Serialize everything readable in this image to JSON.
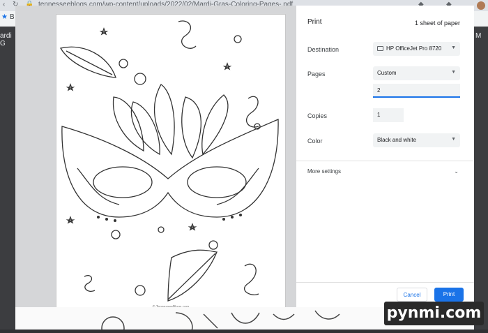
{
  "browser": {
    "url": "tennesseeblogs.com/wp-content/uploads/2022/02/Mardi-Gras-Coloring-Pages-.pdf",
    "bookmark_fragment": "B",
    "left_tab_fragment": "ardi G",
    "right_tab_fragment": "M"
  },
  "print_dialog": {
    "title": "Print",
    "sheets": "1 sheet of paper",
    "destination": {
      "label": "Destination",
      "value": "HP OfficeJet Pro 8720"
    },
    "pages": {
      "label": "Pages",
      "value": "Custom",
      "custom_value": "2"
    },
    "copies": {
      "label": "Copies",
      "value": "1"
    },
    "color": {
      "label": "Color",
      "value": "Black and white"
    },
    "more_settings": "More settings",
    "cancel": "Cancel",
    "print": "Print"
  },
  "preview": {
    "page_footer": "© TennesseeBlogs.com"
  },
  "watermark": "pynmi.com",
  "colors": {
    "accent": "#1a73e8",
    "panel_bg": "#ffffff",
    "preview_bg": "#d5d6d8"
  },
  "icons": [
    "printer-icon",
    "chevron-down-icon",
    "bookmark-star-icon"
  ]
}
